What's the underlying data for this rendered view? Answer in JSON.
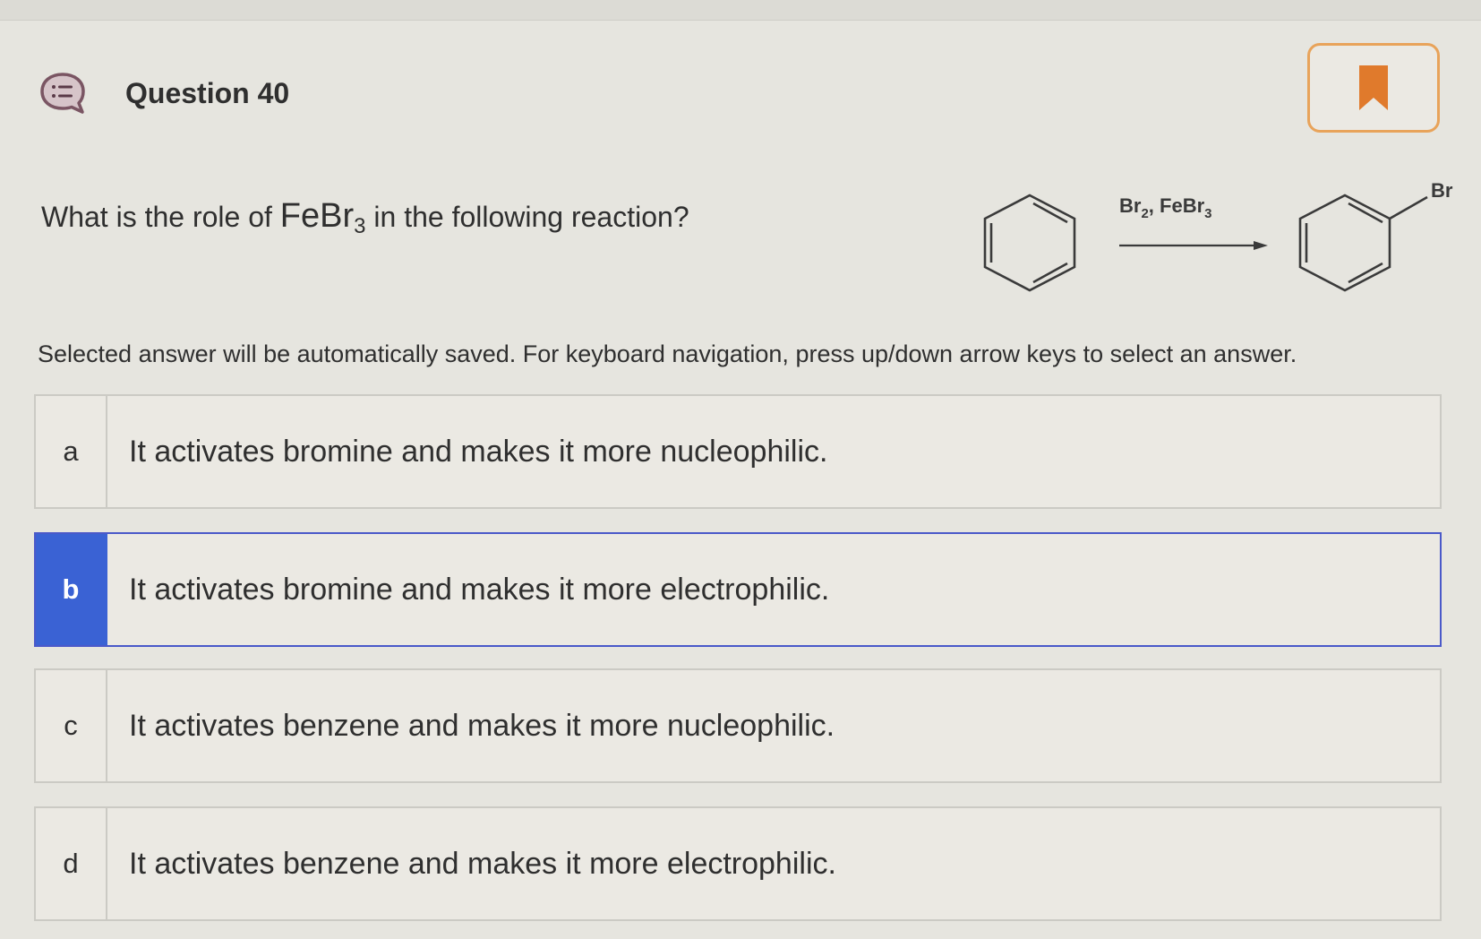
{
  "question": {
    "title": "Question 40",
    "prompt_before": "What is the role of ",
    "formula_main": "FeBr",
    "formula_sub": "3",
    "prompt_after": " in the following reaction?"
  },
  "reaction": {
    "reagent_br": "Br",
    "reagent_br_sub": "2",
    "reagent_comma": ", ",
    "reagent_febr": "FeBr",
    "reagent_febr_sub": "3",
    "product_substituent": "Br"
  },
  "instructions": "Selected answer will be automatically saved. For keyboard navigation, press up/down arrow keys to select an answer.",
  "options": [
    {
      "letter": "a",
      "text": "It activates bromine and makes it more nucleophilic."
    },
    {
      "letter": "b",
      "text": "It activates bromine and makes it more electrophilic."
    },
    {
      "letter": "c",
      "text": "It activates benzene and makes it more nucleophilic."
    },
    {
      "letter": "d",
      "text": "It activates benzene and makes it more electrophilic."
    }
  ],
  "selected_option": "b",
  "colors": {
    "selected_accent": "#3a62d4",
    "bookmark_border": "#e8a35a",
    "bookmark_fill": "#e07a2c",
    "question_icon_fill": "#d6c4c9",
    "question_icon_stroke": "#7a5563"
  },
  "icons": {
    "question_icon": "question-list-icon",
    "bookmark": "bookmark-icon"
  }
}
